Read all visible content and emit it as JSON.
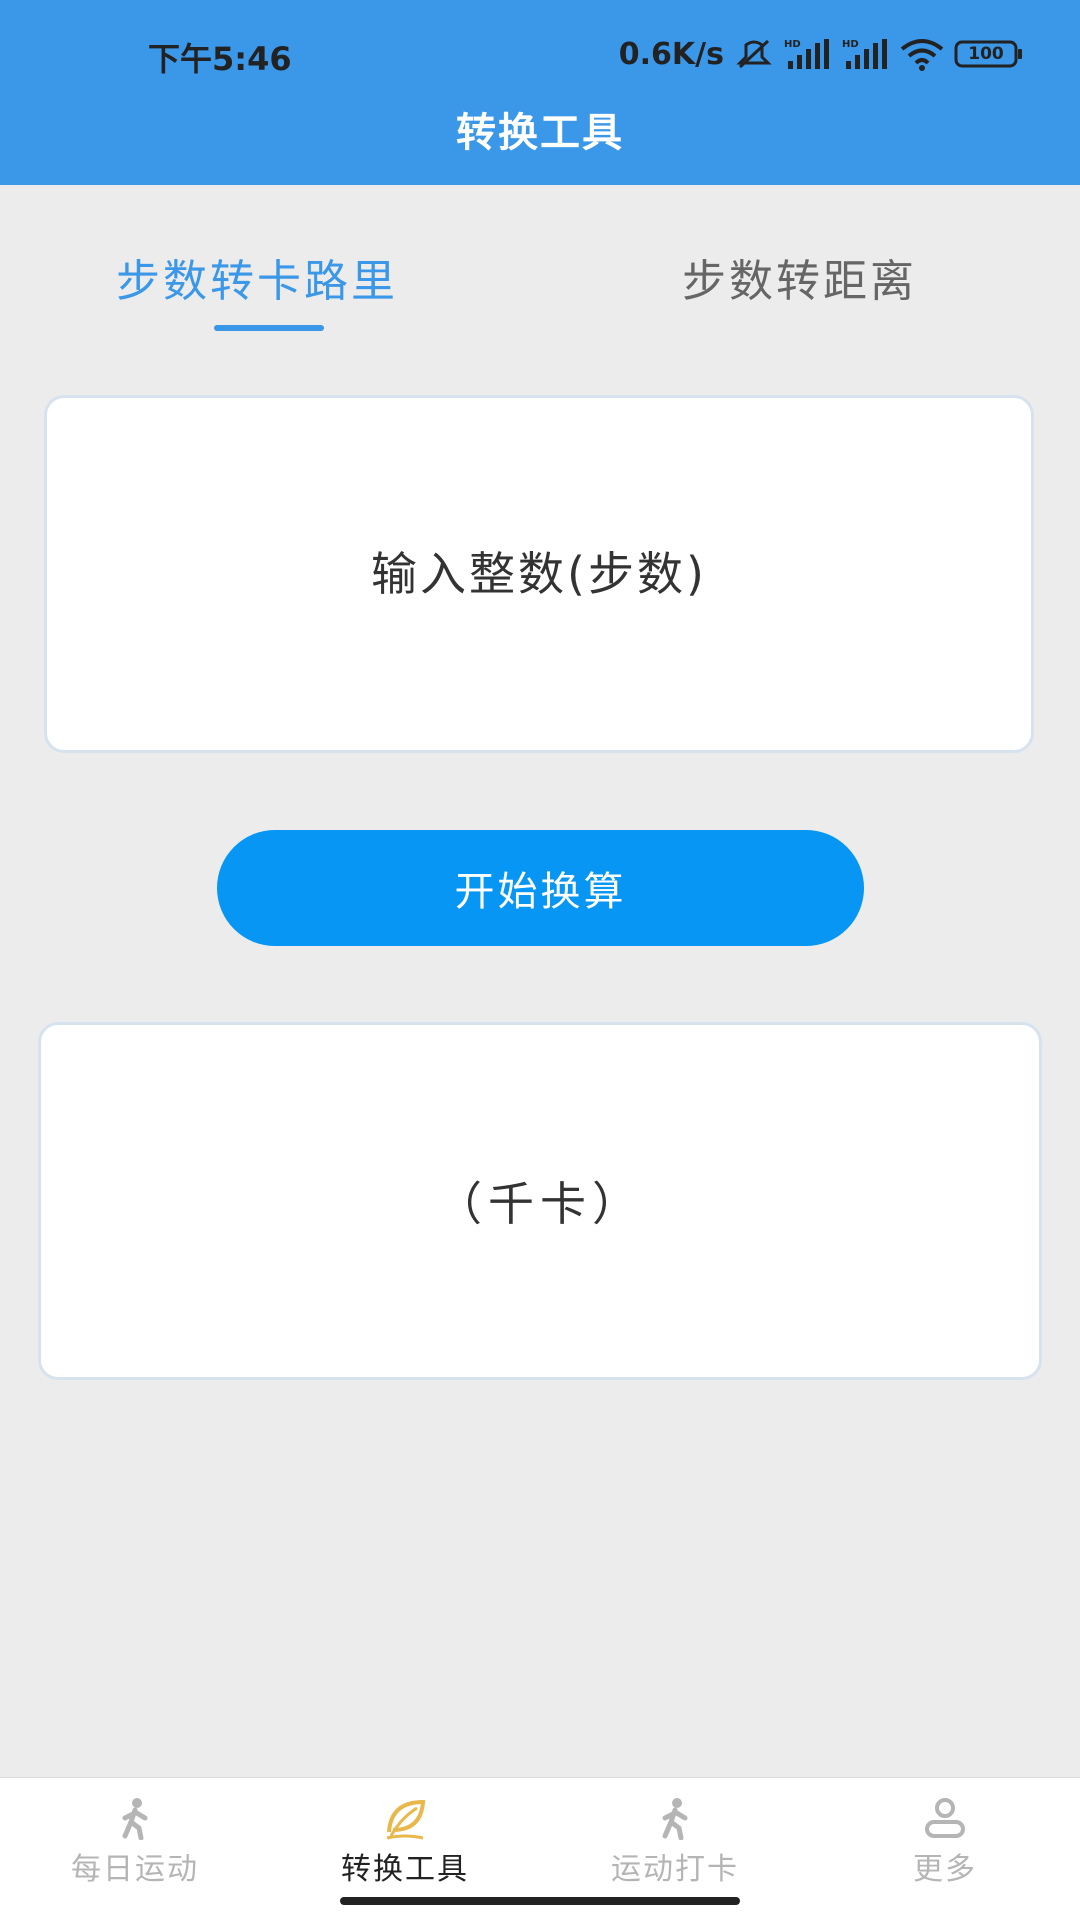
{
  "status_bar": {
    "time": "下午5:46",
    "net_speed": "0.6K/s",
    "battery": "100",
    "icons": [
      "mute-icon",
      "signal-hd-icon",
      "signal-hd-icon",
      "wifi-icon",
      "battery-icon"
    ]
  },
  "header": {
    "title": "转换工具"
  },
  "tabs": [
    {
      "label": "步数转卡路里",
      "active": true
    },
    {
      "label": "步数转距离",
      "active": false
    }
  ],
  "input": {
    "placeholder": "输入整数(步数)",
    "value": ""
  },
  "convert_button": {
    "label": "开始换算"
  },
  "result": {
    "text": "（千卡）"
  },
  "bottom_nav": [
    {
      "label": "每日运动",
      "icon": "runner-icon",
      "active": false
    },
    {
      "label": "转换工具",
      "icon": "leaf-icon",
      "active": true
    },
    {
      "label": "运动打卡",
      "icon": "runner-icon",
      "active": false
    },
    {
      "label": "更多",
      "icon": "user-icon",
      "active": false
    }
  ],
  "colors": {
    "header_bg": "#3b97e8",
    "accent": "#3b97e8",
    "button_bg": "#0896f5",
    "page_bg": "#ececec"
  }
}
